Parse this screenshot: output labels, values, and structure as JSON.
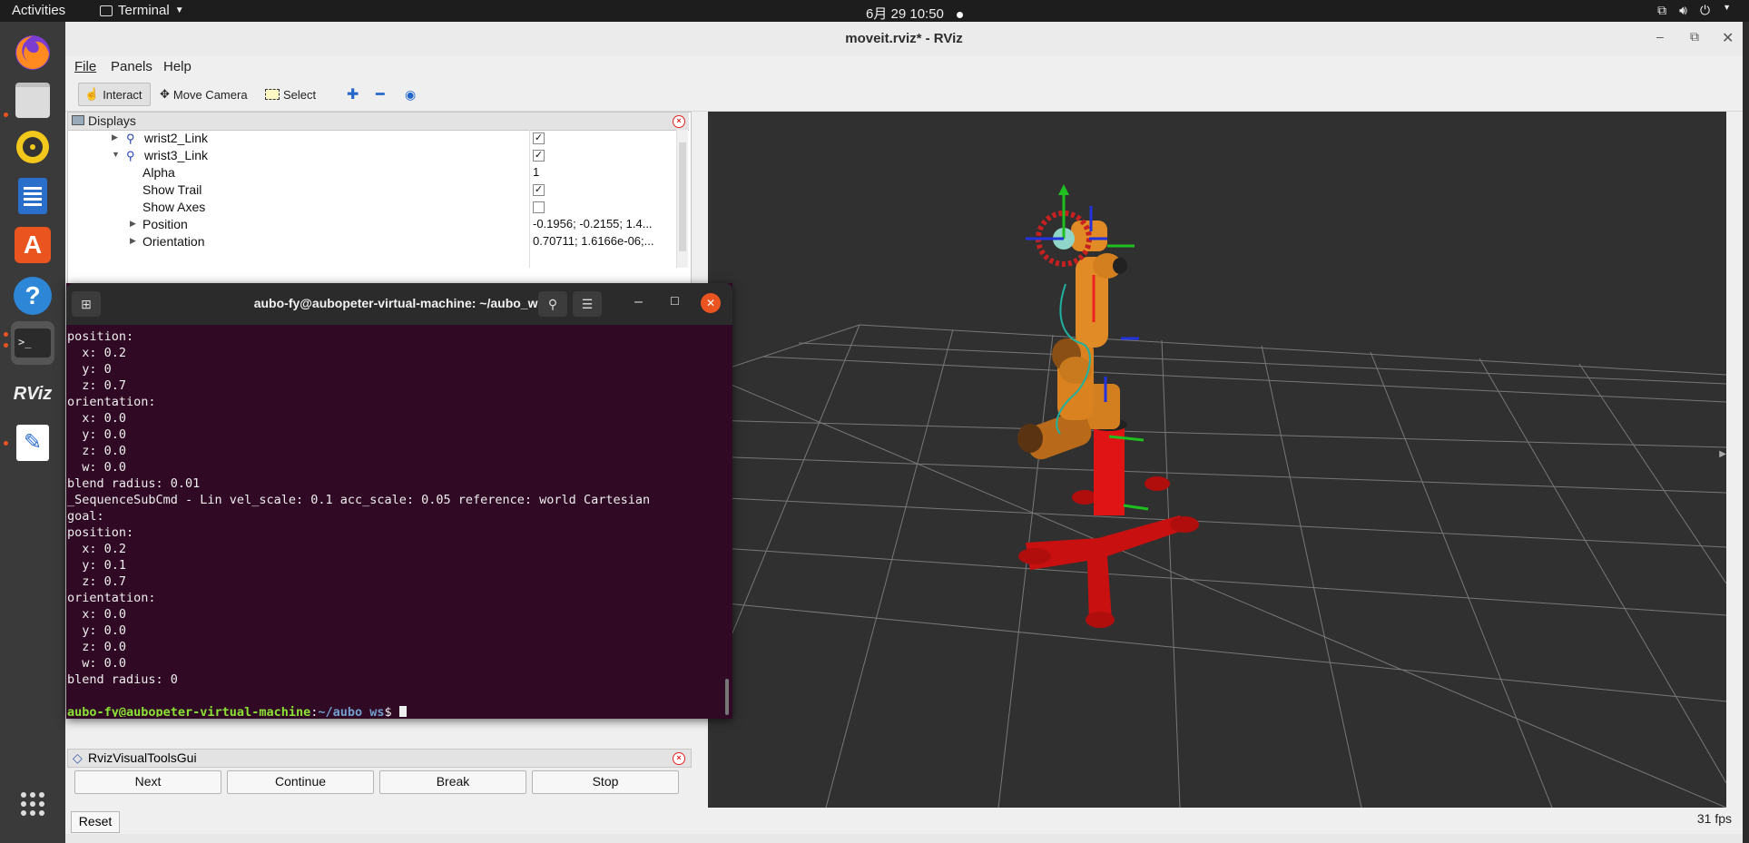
{
  "topbar": {
    "activities": "Activities",
    "app_name": "Terminal",
    "clock": "6月 29  10:50"
  },
  "dock": {
    "items": [
      "firefox-icon",
      "files-icon",
      "rhythmbox-icon",
      "writer-icon",
      "software-icon",
      "help-icon",
      "terminal-icon",
      "rviz-icon",
      "text-editor-icon",
      "app-grid-icon"
    ],
    "rviz_label": "RViz",
    "terminal_label": ">_"
  },
  "rviz": {
    "title": "moveit.rviz* - RViz",
    "menu": {
      "file": "File",
      "panels": "Panels",
      "help": "Help"
    },
    "toolbar": {
      "interact": "Interact",
      "move_camera": "Move Camera",
      "select": "Select"
    },
    "displays": {
      "title": "Displays",
      "rows": [
        {
          "name": "wrist2_Link",
          "checked": true
        },
        {
          "name": "wrist3_Link",
          "checked": true
        },
        {
          "name": "Alpha",
          "value": "1"
        },
        {
          "name": "Show Trail",
          "checked": true
        },
        {
          "name": "Show Axes",
          "checked": false
        },
        {
          "name": "Position",
          "value": "-0.1956; -0.2155; 1.4..."
        },
        {
          "name": "Orientation",
          "value": "0.70711; 1.6166e-06;..."
        }
      ]
    },
    "visual_tools": {
      "title": "RvizVisualToolsGui",
      "next": "Next",
      "continue": "Continue",
      "break": "Break",
      "stop": "Stop"
    },
    "reset": "Reset",
    "fps": "31 fps"
  },
  "terminal": {
    "title": "aubo-fy@aubopeter-virtual-machine: ~/aubo_ws",
    "lines": [
      "position:",
      "  x: 0.2",
      "  y: 0",
      "  z: 0.7",
      "orientation:",
      "  x: 0.0",
      "  y: 0.0",
      "  z: 0.0",
      "  w: 0.0",
      "blend radius: 0.01",
      "_SequenceSubCmd - Lin vel_scale: 0.1 acc_scale: 0.05 reference: world Cartesian",
      "goal:",
      "position:",
      "  x: 0.2",
      "  y: 0.1",
      "  z: 0.7",
      "orientation:",
      "  x: 0.0",
      "  y: 0.0",
      "  z: 0.0",
      "  w: 0.0",
      "blend radius: 0"
    ],
    "prompt_user": "aubo-fy@aubopeter-virtual-machine",
    "prompt_path": "~/aubo_ws",
    "prompt_symbol": "$"
  },
  "colors": {
    "terminal_bg": "#300a24",
    "viewport_bg": "#303030",
    "robot_orange": "#d9821f",
    "robot_base_red": "#dd1111",
    "accent": "#e95420"
  }
}
